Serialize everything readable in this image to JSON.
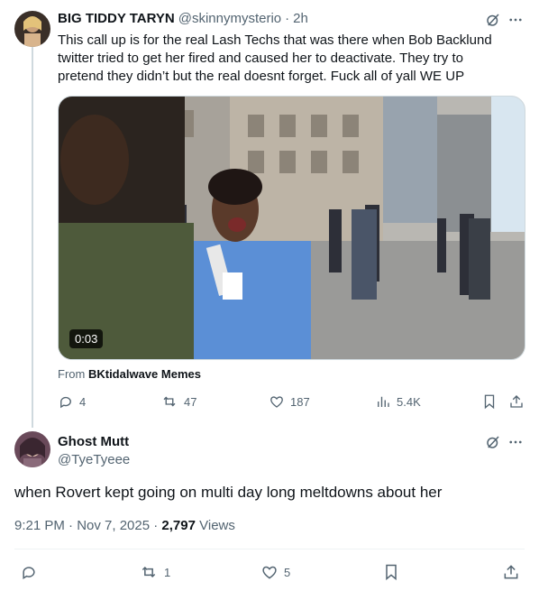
{
  "tweet1": {
    "display_name": "BIG TIDDY TARYN",
    "handle": "@skinnymysterio",
    "separator": "·",
    "time": "2h",
    "text": "This call up is for the real Lash Techs that was there when Bob Backlund twitter tried to get her fired and caused her to deactivate. They try to pretend they didn’t but the real doesnt forget. Fuck all of yall WE UP",
    "video_duration": "0:03",
    "source_prefix": "From",
    "source_name": "BKtidalwave Memes",
    "replies": "4",
    "reposts": "47",
    "likes": "187",
    "views": "5.4K"
  },
  "tweet2": {
    "display_name": "Ghost Mutt",
    "handle": "@TyeTyeee",
    "text": "when Rovert kept going on multi day long meltdowns about her",
    "timestamp": "9:21 PM · Nov 7, 2025 · ",
    "views_count": "2,797",
    "views_label": " Views",
    "reposts": "1",
    "likes": "5"
  },
  "icons": [
    "grok-icon",
    "more-icon",
    "reply-icon",
    "repost-icon",
    "like-icon",
    "views-icon",
    "bookmark-icon",
    "share-icon"
  ],
  "colors": {
    "text": "#0f1419",
    "muted": "#536471",
    "border": "#cfd9de"
  }
}
